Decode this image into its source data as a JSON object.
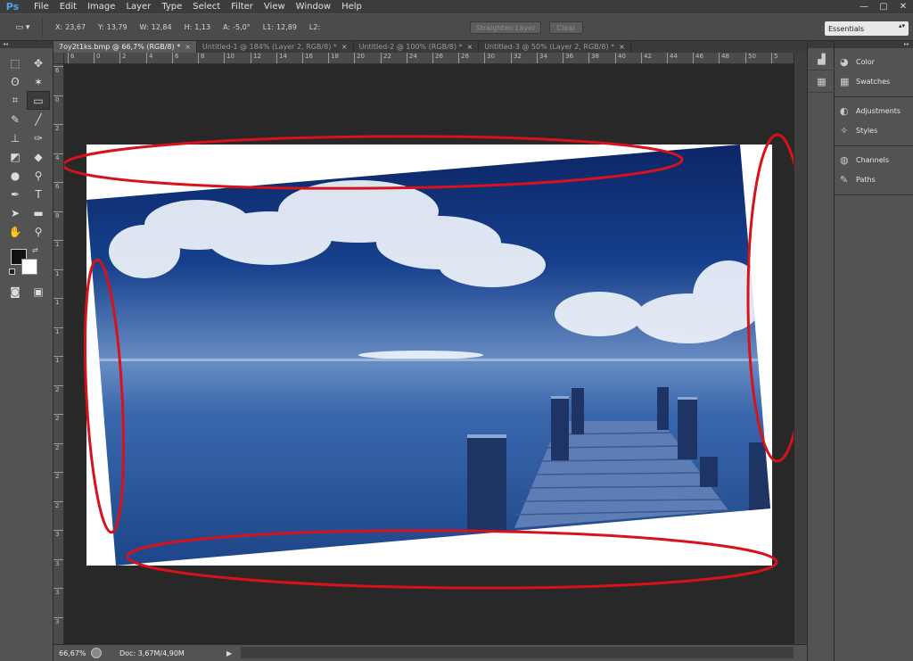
{
  "app": {
    "logo": "Ps",
    "menu": [
      "File",
      "Edit",
      "Image",
      "Layer",
      "Type",
      "Select",
      "Filter",
      "View",
      "Window",
      "Help"
    ],
    "window_controls": [
      "—",
      "▢",
      "✕"
    ]
  },
  "options": {
    "tool_preset": "▭ ▾",
    "fields": [
      {
        "label": "X:",
        "value": "23,67"
      },
      {
        "label": "Y:",
        "value": "13,79"
      },
      {
        "label": "W:",
        "value": "12,84"
      },
      {
        "label": "H:",
        "value": "1,13"
      },
      {
        "label": "A:",
        "value": "-5,0°"
      },
      {
        "label": "L1:",
        "value": "12,89"
      },
      {
        "label": "L2:",
        "value": ""
      }
    ],
    "straighten_label": "Straighten Layer",
    "clear_label": "Clear",
    "workspace": "Essentials"
  },
  "tabs": [
    {
      "label": "7oy2t1ks.bmp @ 66,7% (RGB/8) *",
      "active": true
    },
    {
      "label": "Untitled-1 @ 184% (Layer 2, RGB/8) *",
      "active": false
    },
    {
      "label": "Untitled-2 @ 100% (RGB/8) *",
      "active": false
    },
    {
      "label": "Untitled-3 @ 50% (Layer 2, RGB/8) *",
      "active": false
    }
  ],
  "ruler_h": [
    "6",
    "0",
    "2",
    "4",
    "6",
    "8",
    "10",
    "12",
    "14",
    "16",
    "18",
    "20",
    "22",
    "24",
    "26",
    "28",
    "30",
    "32",
    "34",
    "36",
    "38",
    "40",
    "42",
    "44",
    "46",
    "48",
    "50",
    "5"
  ],
  "ruler_v": [
    "6",
    "0",
    "2",
    "4",
    "6",
    "8",
    "1",
    "1",
    "1",
    "1",
    "1",
    "2",
    "2",
    "2",
    "2",
    "2",
    "3",
    "3",
    "3",
    "3"
  ],
  "status": {
    "zoom": "66,67%",
    "doc": "Doc: 3,67M/4,90M"
  },
  "panels": {
    "groups": [
      [
        {
          "label": "Color",
          "icon": "color-icon"
        },
        {
          "label": "Swatches",
          "icon": "swatches-icon"
        }
      ],
      [
        {
          "label": "Adjustments",
          "icon": "adjustments-icon"
        },
        {
          "label": "Styles",
          "icon": "styles-icon"
        }
      ],
      [
        {
          "label": "Channels",
          "icon": "channels-icon"
        },
        {
          "label": "Paths",
          "icon": "paths-icon"
        }
      ]
    ]
  },
  "colors": {
    "foreground": "#111111",
    "background": "#ffffff",
    "annotation": "#d8121b",
    "sky_top": "#0d2a6b",
    "sea": "#2f5fa6"
  }
}
